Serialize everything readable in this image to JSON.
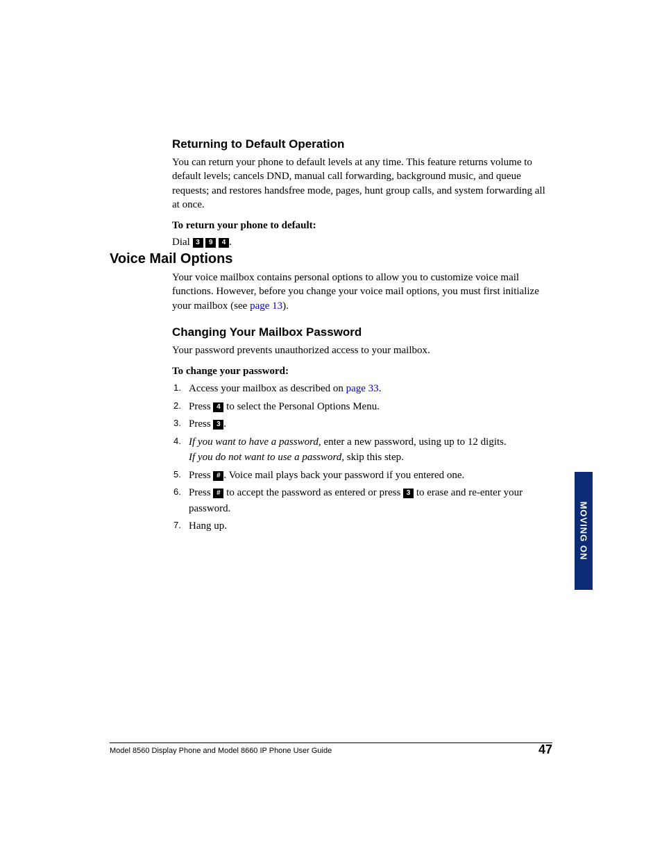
{
  "section1": {
    "heading": "Returning to Default Operation",
    "para": "You can return your phone to default levels at any time. This feature returns volume to default levels; cancels DND, manual call forwarding, background music, and queue requests; and restores handsfree mode, pages, hunt group calls, and system forwarding all at once.",
    "lead": "To return your phone to default:",
    "dial_prefix": "Dial ",
    "key1": "3",
    "key2": "9",
    "key3": "4",
    "dial_suffix": "."
  },
  "section2": {
    "heading": "Voice Mail Options",
    "para_a": "Your voice mailbox contains personal options to allow you to customize voice mail functions. However, before you change your voice mail options, you must first initialize your mailbox (see ",
    "link": "page 13",
    "para_b": ")."
  },
  "section3": {
    "heading": "Changing Your Mailbox Password",
    "para": "Your password prevents unauthorized access to your mailbox.",
    "lead": "To change your password:",
    "steps": {
      "s1a": "Access your mailbox as described on ",
      "s1link": "page 33",
      "s1b": ".",
      "s2a": "Press ",
      "s2key": "4",
      "s2b": " to select the Personal Options Menu.",
      "s3a": "Press ",
      "s3key": "3",
      "s3b": ".",
      "s4i1": "If you want to have a password,",
      "s4a": " enter a new password, using up to 12 digits.",
      "s4i2": "If you do not want to use a password,",
      "s4b": " skip this step.",
      "s5a": "Press ",
      "s5key": "#",
      "s5b": ". Voice mail plays back your password if you entered one.",
      "s6a": "Press ",
      "s6key1": "#",
      "s6b": " to accept the password as entered or press ",
      "s6key2": "3",
      "s6c": " to erase and re-enter your password.",
      "s7": "Hang up."
    }
  },
  "sidetab": "MOVING ON",
  "footer": {
    "left": "Model 8560 Display Phone and Model 8660 IP Phone User Guide",
    "right": "47"
  }
}
